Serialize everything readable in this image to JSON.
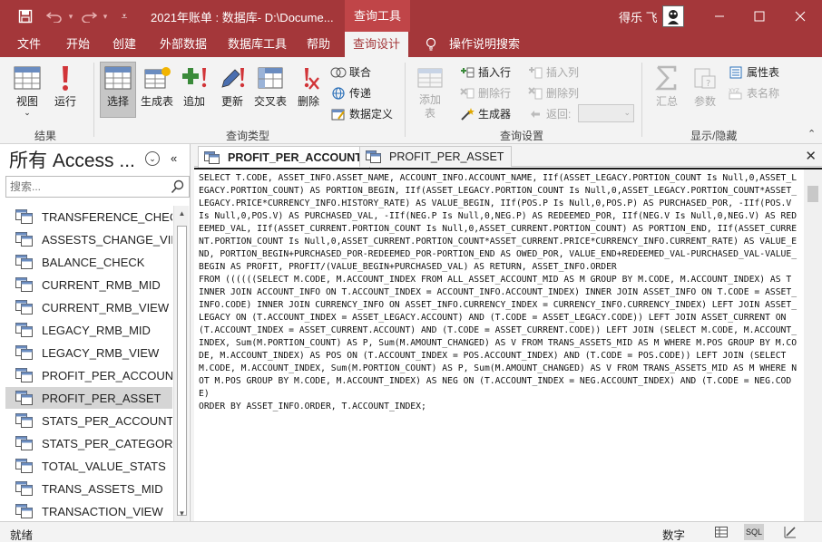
{
  "titlebar": {
    "title": "2021年账单 : 数据库- D:\\Docume...",
    "context_tab": "查询工具",
    "user": "得乐 飞"
  },
  "tabs": [
    "文件",
    "开始",
    "创建",
    "外部数据",
    "数据库工具",
    "帮助",
    "查询设计",
    "操作说明搜索"
  ],
  "ribbon": {
    "results": {
      "view": "视图",
      "run": "运行",
      "label": "结果"
    },
    "query_type": {
      "select": "选择",
      "make_table": "生成表",
      "append": "追加",
      "update": "更新",
      "crosstab": "交叉表",
      "delete": "删除",
      "union": "联合",
      "pass_through": "传递",
      "data_definition": "数据定义",
      "label": "查询类型"
    },
    "setup": {
      "add_table": "添加表",
      "insert_rows": "插入行",
      "delete_rows": "删除行",
      "builder": "生成器",
      "insert_columns": "插入列",
      "delete_columns": "删除列",
      "return": "返回:",
      "label": "查询设置"
    },
    "show_hide": {
      "totals": "汇总",
      "parameters": "参数",
      "property_sheet": "属性表",
      "table_names": "表名称",
      "label": "显示/隐藏"
    }
  },
  "nav": {
    "title": "所有 Access ...",
    "search_placeholder": "搜索...",
    "items": [
      "TRANSFERENCE_CHECK",
      "ASSESTS_CHANGE_VIE...",
      "BALANCE_CHECK",
      "CURRENT_RMB_MID",
      "CURRENT_RMB_VIEW",
      "LEGACY_RMB_MID",
      "LEGACY_RMB_VIEW",
      "PROFIT_PER_ACCOUNT",
      "PROFIT_PER_ASSET",
      "STATS_PER_ACCOUNT",
      "STATS_PER_CATEGORY",
      "TOTAL_VALUE_STATS",
      "TRANS_ASSETS_MID",
      "TRANSACTION_VIEW"
    ],
    "selected_index": 8
  },
  "doc_tabs": [
    "PROFIT_PER_ACCOUNT",
    "PROFIT_PER_ASSET"
  ],
  "active_doc_tab": 0,
  "sql_text": "SELECT T.CODE, ASSET_INFO.ASSET_NAME, ACCOUNT_INFO.ACCOUNT_NAME, IIf(ASSET_LEGACY.PORTION_COUNT Is Null,0,ASSET_LEGACY.PORTION_COUNT) AS PORTION_BEGIN, IIf(ASSET_LEGACY.PORTION_COUNT Is Null,0,ASSET_LEGACY.PORTION_COUNT*ASSET_LEGACY.PRICE*CURRENCY_INFO.HISTORY_RATE) AS VALUE_BEGIN, IIf(POS.P Is Null,0,POS.P) AS PURCHASED_POR, -IIf(POS.V Is Null,0,POS.V) AS PURCHASED_VAL, -IIf(NEG.P Is Null,0,NEG.P) AS REDEEMED_POR, IIf(NEG.V Is Null,0,NEG.V) AS REDEEMED_VAL, IIf(ASSET_CURRENT.PORTION_COUNT Is Null,0,ASSET_CURRENT.PORTION_COUNT) AS PORTION_END, IIf(ASSET_CURRENT.PORTION_COUNT Is Null,0,ASSET_CURRENT.PORTION_COUNT*ASSET_CURRENT.PRICE*CURRENCY_INFO.CURRENT_RATE) AS VALUE_END, PORTION_BEGIN+PURCHASED_POR-REDEEMED_POR-PORTION_END AS OWED_POR, VALUE_END+REDEEMED_VAL-PURCHASED_VAL-VALUE_BEGIN AS PROFIT, PROFIT/(VALUE_BEGIN+PURCHASED_VAL) AS RETURN, ASSET_INFO.ORDER\nFROM ((((((SELECT M.CODE, M.ACCOUNT_INDEX FROM ALL_ASSET_ACCOUNT_MID AS M GROUP BY M.CODE, M.ACCOUNT_INDEX) AS T INNER JOIN ACCOUNT_INFO ON T.ACCOUNT_INDEX = ACCOUNT_INFO.ACCOUNT_INDEX) INNER JOIN ASSET_INFO ON T.CODE = ASSET_INFO.CODE) INNER JOIN CURRENCY_INFO ON ASSET_INFO.CURRENCY_INDEX = CURRENCY_INFO.CURRENCY_INDEX) LEFT JOIN ASSET_LEGACY ON (T.ACCOUNT_INDEX = ASSET_LEGACY.ACCOUNT) AND (T.CODE = ASSET_LEGACY.CODE)) LEFT JOIN ASSET_CURRENT ON (T.ACCOUNT_INDEX = ASSET_CURRENT.ACCOUNT) AND (T.CODE = ASSET_CURRENT.CODE)) LEFT JOIN (SELECT M.CODE, M.ACCOUNT_INDEX, Sum(M.PORTION_COUNT) AS P, Sum(M.AMOUNT_CHANGED) AS V FROM TRANS_ASSETS_MID AS M WHERE M.POS GROUP BY M.CODE, M.ACCOUNT_INDEX) AS POS ON (T.ACCOUNT_INDEX = POS.ACCOUNT_INDEX) AND (T.CODE = POS.CODE)) LEFT JOIN (SELECT M.CODE, M.ACCOUNT_INDEX, Sum(M.PORTION_COUNT) AS P, Sum(M.AMOUNT_CHANGED) AS V FROM TRANS_ASSETS_MID AS M WHERE NOT M.POS GROUP BY M.CODE, M.ACCOUNT_INDEX) AS NEG ON (T.ACCOUNT_INDEX = NEG.ACCOUNT_INDEX) AND (T.CODE = NEG.CODE)\nORDER BY ASSET_INFO.ORDER, T.ACCOUNT_INDEX;",
  "status": {
    "left": "就绪",
    "mode": "数字",
    "sql_view": "SQL"
  },
  "colors": {
    "titlebar": "#a4373a",
    "accent": "#a4373a",
    "selected_item": "#d5d5d5"
  },
  "icons": [
    "save-icon",
    "undo-icon",
    "redo-icon",
    "query-icon",
    "search-icon"
  ]
}
